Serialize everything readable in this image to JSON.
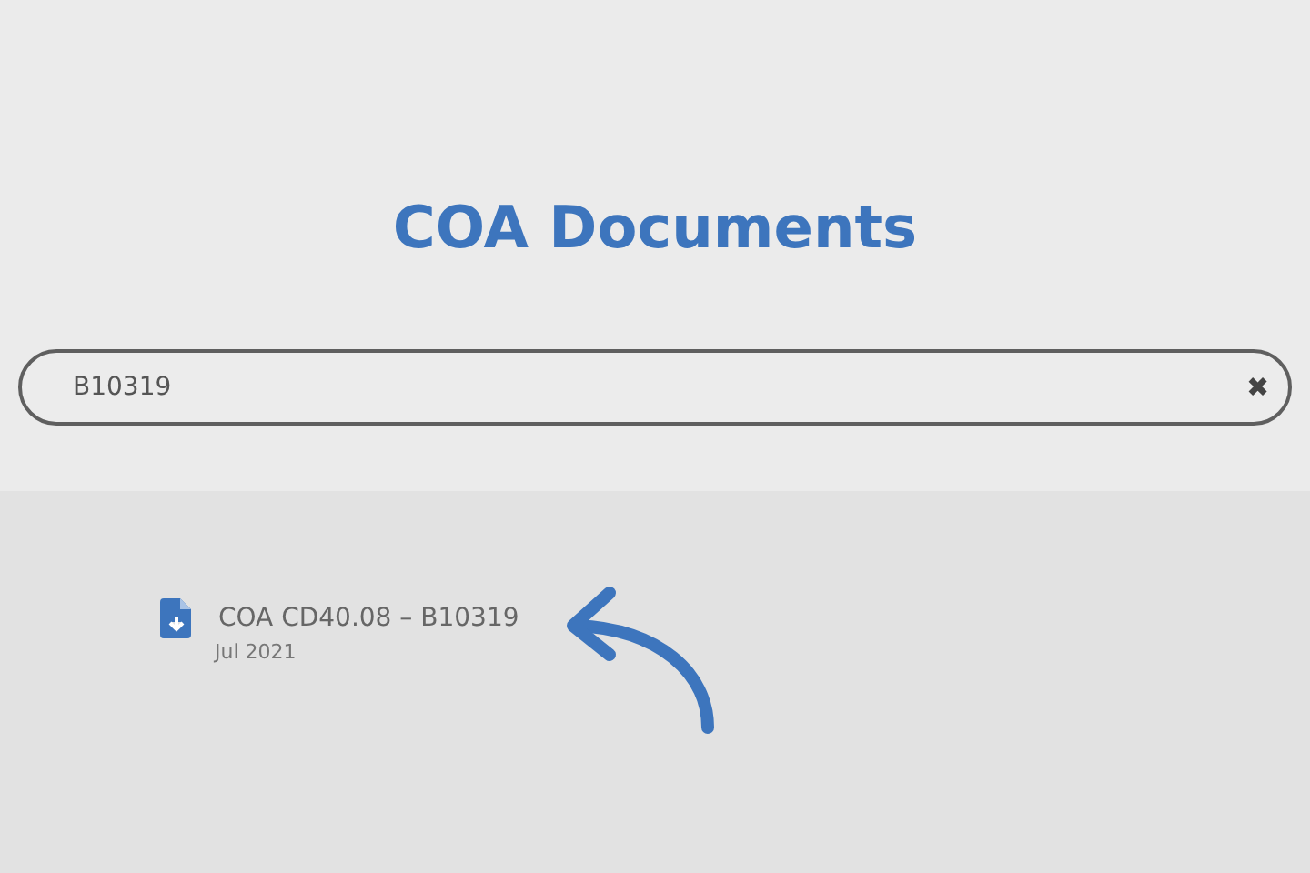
{
  "header": {
    "title": "COA Documents"
  },
  "search": {
    "value": "B10319",
    "clear_icon": "✖"
  },
  "results": [
    {
      "title": "COA CD40.08 – B10319",
      "date": "Jul 2021"
    }
  ]
}
